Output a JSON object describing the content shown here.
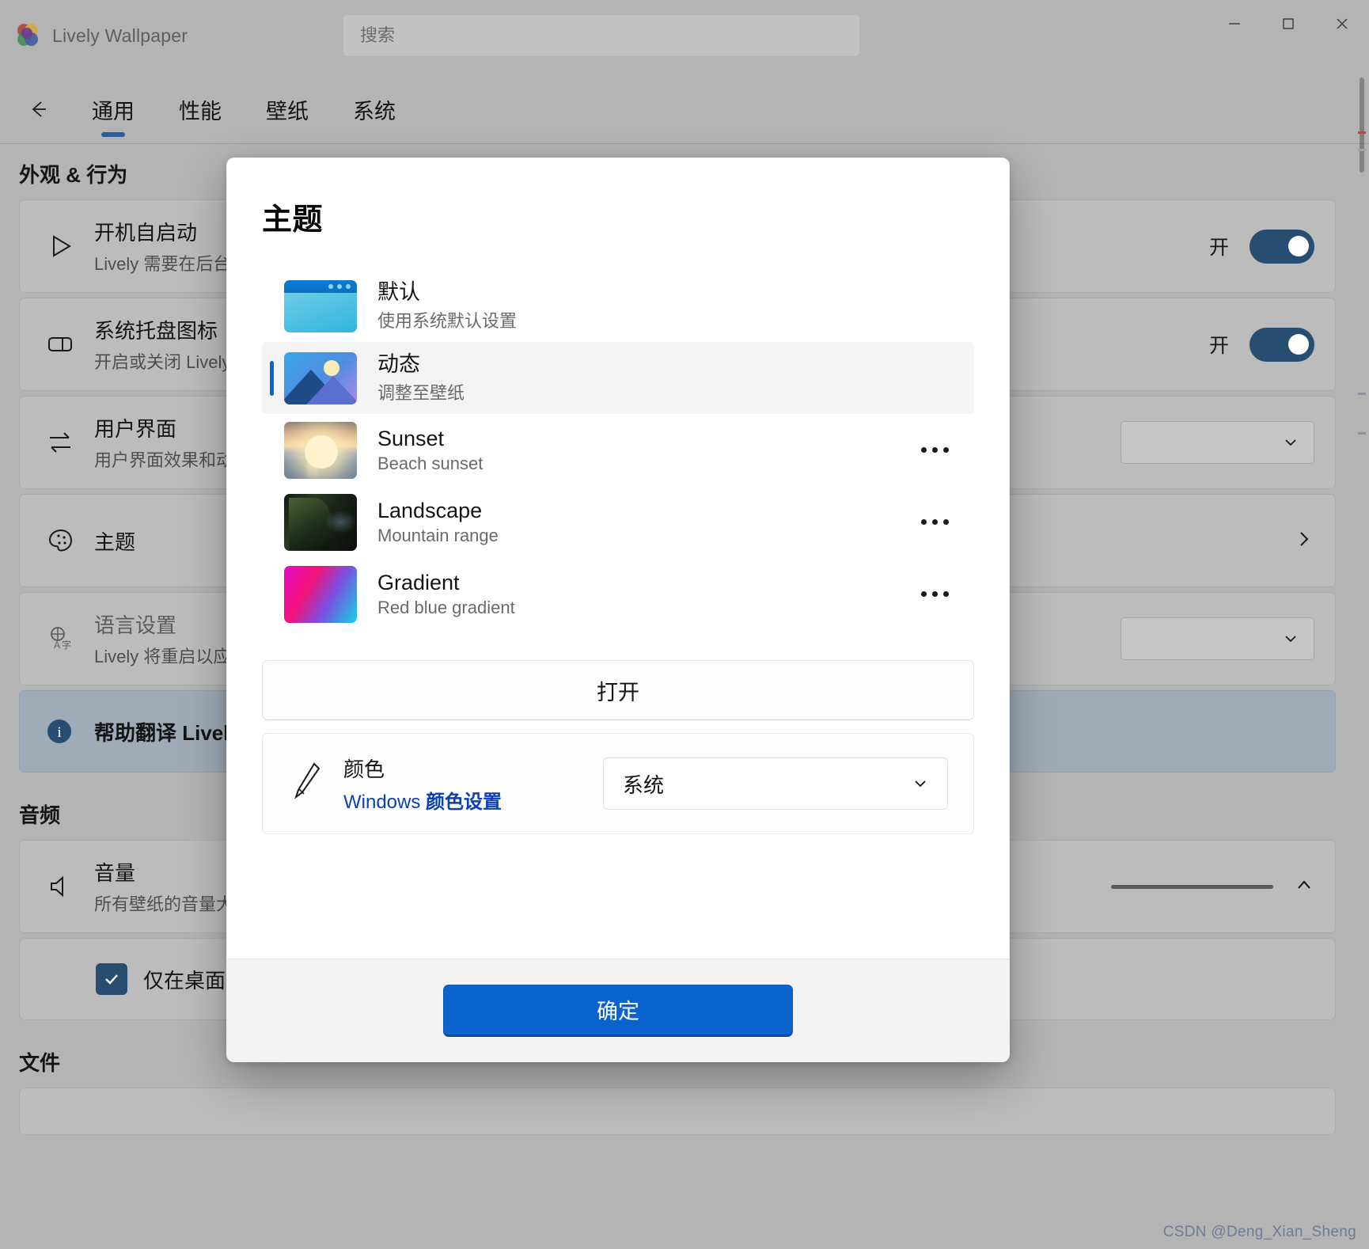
{
  "window": {
    "app_title": "Lively Wallpaper",
    "logo_icon": "lively-flower-logo",
    "minimize_icon": "minimize-icon",
    "maximize_icon": "maximize-icon",
    "close_icon": "close-icon"
  },
  "search": {
    "placeholder": "搜索",
    "value": ""
  },
  "nav": {
    "back_icon": "arrow-left-icon",
    "tabs": [
      {
        "label": "通用",
        "active": true
      },
      {
        "label": "性能",
        "active": false
      },
      {
        "label": "壁纸",
        "active": false
      },
      {
        "label": "系统",
        "active": false
      }
    ]
  },
  "settings": {
    "sections": [
      {
        "title": "外观 & 行为",
        "items": [
          {
            "icon": "play-triangle-icon",
            "title": "开机自启动",
            "sub": "Lively 需要在后台",
            "control": "toggle",
            "toggle_label": "开",
            "toggle_on": true
          },
          {
            "icon": "tray-icon",
            "title": "系统托盘图标",
            "sub": "开启或关闭 Lively",
            "control": "toggle",
            "toggle_label": "开",
            "toggle_on": true
          },
          {
            "icon": "swap-arrows-icon",
            "title": "用户界面",
            "sub": "用户界面效果和动",
            "control": "combo"
          },
          {
            "icon": "palette-icon",
            "title": "主题",
            "sub": "",
            "control": "chevron"
          },
          {
            "icon": "language-icon",
            "title": "语言设置",
            "sub": "Lively 将重启以应",
            "control": "combo",
            "muted": true
          },
          {
            "icon": "info-circle-icon",
            "title": "帮助翻译 Lively ,",
            "sub": "",
            "control": "none",
            "accent": true,
            "bold": true
          }
        ]
      },
      {
        "title": "音频",
        "items": [
          {
            "icon": "speaker-icon",
            "title": "音量",
            "sub": "所有壁纸的音量大",
            "control": "slider-collapse"
          },
          {
            "icon": "checkbox-icon",
            "title": "仅在桌面为",
            "sub": "",
            "control": "checkbox",
            "checked": true
          }
        ]
      },
      {
        "title": "文件",
        "items": []
      }
    ]
  },
  "dialog": {
    "title": "主题",
    "themes": [
      {
        "thumb": "default-window-thumb",
        "name": "默认",
        "desc": "使用系统默认设置",
        "selected": false,
        "has_more": false
      },
      {
        "thumb": "dynamic-mountain-thumb",
        "name": "动态",
        "desc": "调整至壁纸",
        "selected": true,
        "has_more": false
      },
      {
        "thumb": "sunset-photo-thumb",
        "name": "Sunset",
        "desc": "Beach sunset",
        "selected": false,
        "has_more": true
      },
      {
        "thumb": "landscape-photo-thumb",
        "name": "Landscape",
        "desc": "Mountain range",
        "selected": false,
        "has_more": true
      },
      {
        "thumb": "gradient-thumb",
        "name": "Gradient",
        "desc": "Red blue gradient",
        "selected": false,
        "has_more": true
      }
    ],
    "open_button": "打开",
    "color": {
      "icon": "paintbrush-icon",
      "label": "颜色",
      "link_prefix": "Windows ",
      "link_bold": "颜色设置",
      "select_value": "系统",
      "select_icon": "chevron-down-icon"
    },
    "confirm_button": "确定"
  },
  "watermark": "CSDN @Deng_Xian_Sheng",
  "colors": {
    "accent": "#0b63ce",
    "toggle_on": "#0d5291",
    "link": "#0b3fb5",
    "dialog_bg": "#ffffff",
    "footer_bg": "#f3f3f3",
    "app_bg": "#b4b4b4",
    "selected_row": "#f4f4f4"
  }
}
